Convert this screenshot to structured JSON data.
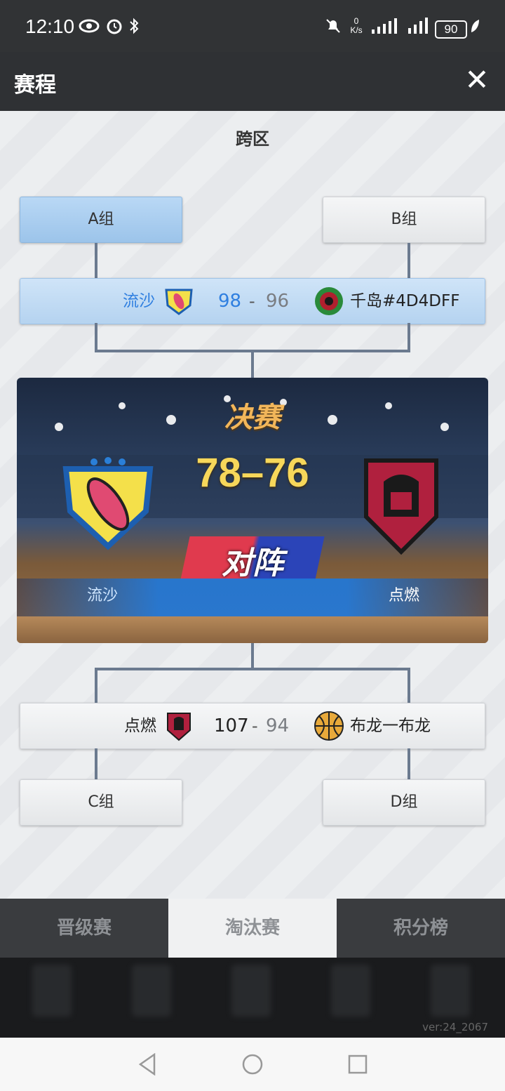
{
  "status_bar": {
    "time": "12:10",
    "net_speed_top": "0",
    "net_speed_unit": "K/s",
    "battery": "90"
  },
  "header": {
    "title": "赛程",
    "close_icon": "close-icon"
  },
  "section": {
    "title": "跨区"
  },
  "groups": {
    "a": "A组",
    "b": "B组",
    "c": "C组",
    "d": "D组"
  },
  "semifinal_top": {
    "team_left": "流沙",
    "score_left": "98",
    "score_right": "96",
    "team_right": "千岛#4D4DFF"
  },
  "final": {
    "title": "决赛",
    "score": "78–76",
    "vs": "对阵",
    "team_left": "流沙",
    "team_right": "点燃"
  },
  "semifinal_bottom": {
    "team_left": "点燃",
    "score_left": "107",
    "score_right": "94",
    "team_right": "布龙一布龙"
  },
  "tabs": [
    {
      "label": "晋级赛"
    },
    {
      "label": "淘汰赛"
    },
    {
      "label": "积分榜"
    }
  ],
  "version": "ver:24_2067",
  "colors": {
    "winner_blue": "#2f7fe0",
    "loser_gray": "#7a7d82",
    "final_gold": "#f7d75a"
  }
}
